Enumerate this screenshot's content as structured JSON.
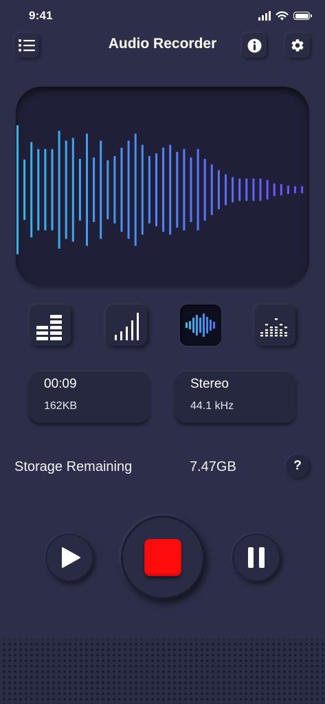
{
  "status_bar": {
    "time": "9:41",
    "icons": [
      "cellular-signal-icon",
      "wifi-icon",
      "battery-icon"
    ]
  },
  "header": {
    "title": "Audio Recorder",
    "left_button_icon": "list-icon",
    "info_button_icon": "info-icon",
    "settings_button_icon": "gear-icon"
  },
  "waveform": {
    "colors": {
      "start": "#37b8ea",
      "end": "#6e50ff"
    },
    "amplitudes": [
      0.92,
      0.43,
      0.68,
      0.58,
      0.58,
      0.58,
      0.84,
      0.7,
      0.74,
      0.44,
      0.8,
      0.46,
      0.7,
      0.42,
      0.48,
      0.6,
      0.7,
      0.8,
      0.64,
      0.48,
      0.52,
      0.6,
      0.64,
      0.54,
      0.58,
      0.46,
      0.58,
      0.44,
      0.36,
      0.28,
      0.22,
      0.18,
      0.16,
      0.16,
      0.16,
      0.16,
      0.14,
      0.09,
      0.08,
      0.06,
      0.05,
      0.05
    ]
  },
  "mode_buttons": [
    {
      "icon": "level-meter-icon",
      "active": false
    },
    {
      "icon": "ascending-bars-icon",
      "active": false
    },
    {
      "icon": "waveform-icon",
      "active": true
    },
    {
      "icon": "spectrum-dots-icon",
      "active": false
    }
  ],
  "recording_info": {
    "duration": "00:09",
    "file_size": "162KB",
    "channel_mode": "Stereo",
    "sample_rate": "44.1 kHz"
  },
  "storage": {
    "label": "Storage Remaining",
    "value": "7.47GB",
    "help_label": "?"
  },
  "controls": {
    "play_icon": "play-icon",
    "stop_icon": "stop-icon",
    "pause_icon": "pause-icon",
    "stop_color": "#ff0d0d"
  }
}
